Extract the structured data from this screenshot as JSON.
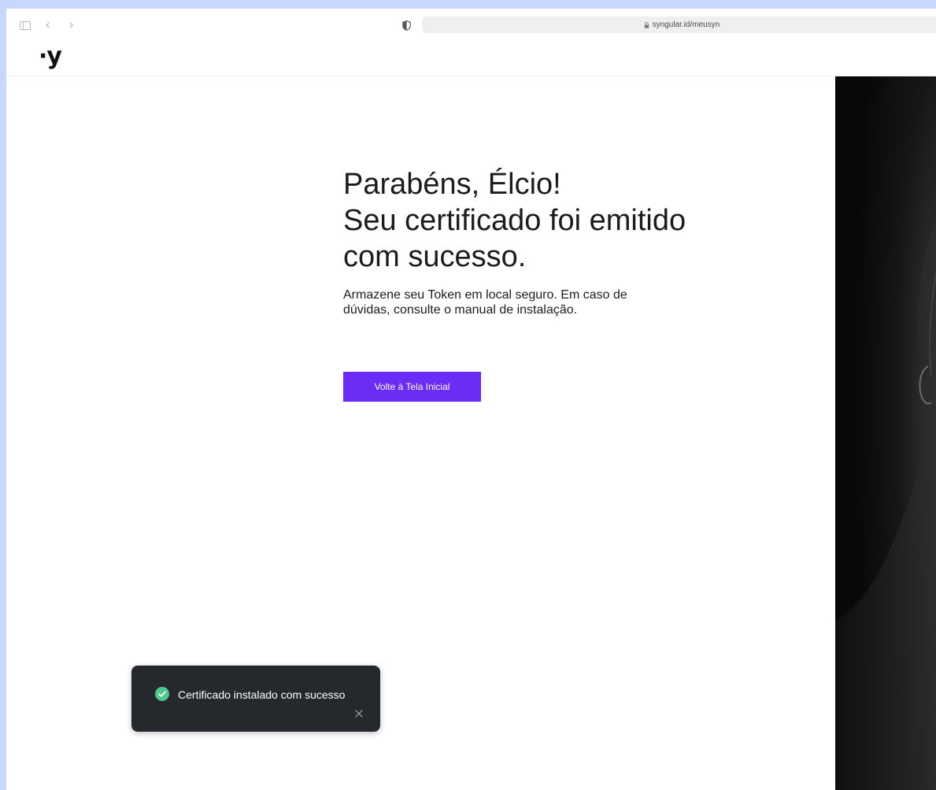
{
  "browser": {
    "url": "syngular.id/meusyn",
    "back_glyph": "‹",
    "forward_glyph": "›"
  },
  "header": {
    "logo_text": "·y"
  },
  "main": {
    "headline_line1": "Parabéns, Élcio!",
    "headline_line2": "Seu certificado foi emitido",
    "headline_line3": "com sucesso.",
    "subtext": "Armazene seu Token em local seguro. Em caso de dúvidas, consulte o manual de instalação.",
    "button_label": "Volte à Tela Inicial"
  },
  "toast": {
    "message": "Certificado instalado com sucesso"
  },
  "colors": {
    "accent": "#6b2cf5",
    "success": "#4cc98a",
    "toast_bg": "#25282d",
    "page_bg": "#c9d7ff"
  },
  "icons": {
    "sidebar": "sidebar-toggle-icon",
    "back": "chevron-left-icon",
    "forward": "chevron-right-icon",
    "shield": "shield-icon",
    "lock": "lock-icon",
    "check": "check-circle-icon",
    "close": "close-icon"
  }
}
